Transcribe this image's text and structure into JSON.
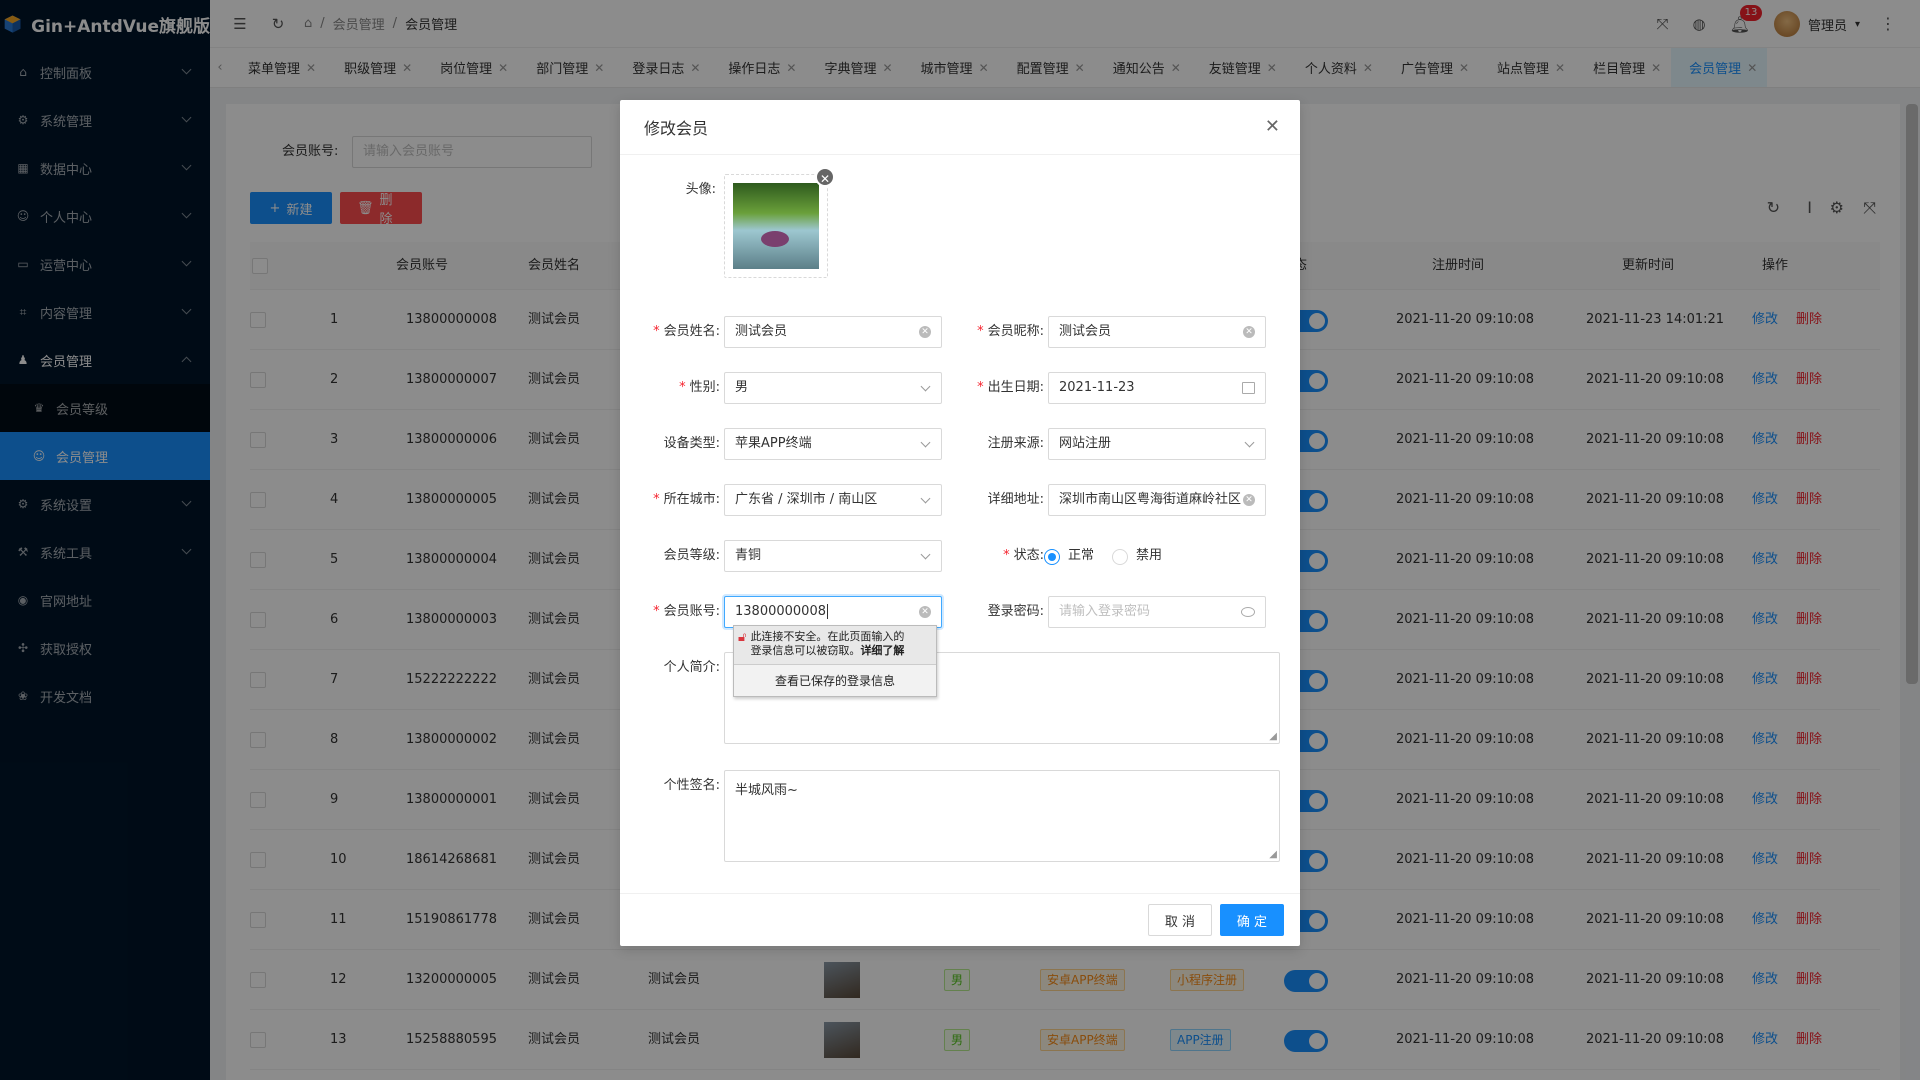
{
  "app": {
    "title": "Gin+AntdVue旗舰版"
  },
  "sidebar": {
    "items": [
      {
        "label": "控制面板",
        "icon": "home-icon"
      },
      {
        "label": "系统管理",
        "icon": "settings-icon"
      },
      {
        "label": "数据中心",
        "icon": "grid-icon"
      },
      {
        "label": "个人中心",
        "icon": "user-icon"
      },
      {
        "label": "运营中心",
        "icon": "monitor-icon"
      },
      {
        "label": "内容管理",
        "icon": "scan-icon"
      },
      {
        "label": "会员管理",
        "icon": "users-icon"
      },
      {
        "label": "会员等级",
        "icon": "crown-icon"
      },
      {
        "label": "会员管理",
        "icon": "user-icon"
      },
      {
        "label": "系统设置",
        "icon": "settings-icon"
      },
      {
        "label": "系统工具",
        "icon": "tool-icon"
      },
      {
        "label": "官网地址",
        "icon": "globe-icon"
      },
      {
        "label": "获取授权",
        "icon": "key-icon"
      },
      {
        "label": "开发文档",
        "icon": "doc-icon"
      }
    ]
  },
  "header": {
    "breadcrumb": [
      "会员管理",
      "会员管理"
    ],
    "notification_count": "13",
    "user_name": "管理员"
  },
  "tabs": [
    "菜单管理",
    "职级管理",
    "岗位管理",
    "部门管理",
    "登录日志",
    "操作日志",
    "字典管理",
    "城市管理",
    "配置管理",
    "通知公告",
    "友链管理",
    "个人资料",
    "广告管理",
    "站点管理",
    "栏目管理",
    "会员管理"
  ],
  "search": {
    "label": "会员账号:",
    "placeholder": "请输入会员账号"
  },
  "toolbar": {
    "new_label": "新建",
    "delete_label": "删除"
  },
  "table": {
    "headers": {
      "account": "会员账号",
      "name": "会员姓名",
      "status": "态",
      "reg_time": "注册时间",
      "upd_time": "更新时间",
      "ops": "操作"
    },
    "edit_label": "修改",
    "delete_label": "删除",
    "rows": [
      {
        "idx": "1",
        "account": "13800000008",
        "name": "测试会员",
        "reg": "2021-11-20 09:10:08",
        "upd": "2021-11-23 14:01:21"
      },
      {
        "idx": "2",
        "account": "13800000007",
        "name": "测试会员",
        "reg": "2021-11-20 09:10:08",
        "upd": "2021-11-20 09:10:08"
      },
      {
        "idx": "3",
        "account": "13800000006",
        "name": "测试会员",
        "reg": "2021-11-20 09:10:08",
        "upd": "2021-11-20 09:10:08"
      },
      {
        "idx": "4",
        "account": "13800000005",
        "name": "测试会员",
        "reg": "2021-11-20 09:10:08",
        "upd": "2021-11-20 09:10:08"
      },
      {
        "idx": "5",
        "account": "13800000004",
        "name": "测试会员",
        "reg": "2021-11-20 09:10:08",
        "upd": "2021-11-20 09:10:08"
      },
      {
        "idx": "6",
        "account": "13800000003",
        "name": "测试会员",
        "reg": "2021-11-20 09:10:08",
        "upd": "2021-11-20 09:10:08"
      },
      {
        "idx": "7",
        "account": "15222222222",
        "name": "测试会员",
        "reg": "2021-11-20 09:10:08",
        "upd": "2021-11-20 09:10:08"
      },
      {
        "idx": "8",
        "account": "13800000002",
        "name": "测试会员",
        "reg": "2021-11-20 09:10:08",
        "upd": "2021-11-20 09:10:08"
      },
      {
        "idx": "9",
        "account": "13800000001",
        "name": "测试会员",
        "reg": "2021-11-20 09:10:08",
        "upd": "2021-11-20 09:10:08"
      },
      {
        "idx": "10",
        "account": "18614268681",
        "name": "测试会员",
        "reg": "2021-11-20 09:10:08",
        "upd": "2021-11-20 09:10:08"
      },
      {
        "idx": "11",
        "account": "15190861778",
        "name": "测试会员",
        "reg": "2021-11-20 09:10:08",
        "upd": "2021-11-20 09:10:08"
      },
      {
        "idx": "12",
        "account": "13200000005",
        "name": "测试会员",
        "nick": "测试会员",
        "gender": "男",
        "device": "安卓APP终端",
        "source": "小程序注册",
        "reg": "2021-11-20 09:10:08",
        "upd": "2021-11-20 09:10:08"
      },
      {
        "idx": "13",
        "account": "15258880595",
        "name": "测试会员",
        "nick": "测试会员",
        "gender": "男",
        "device": "安卓APP终端",
        "source": "APP注册",
        "reg": "2021-11-20 09:10:08",
        "upd": "2021-11-20 09:10:08"
      }
    ]
  },
  "modal": {
    "title": "修改会员",
    "avatar_label": "头像:",
    "fields": {
      "name": {
        "label": "会员姓名:",
        "value": "测试会员"
      },
      "nickname": {
        "label": "会员昵称:",
        "value": "测试会员"
      },
      "gender": {
        "label": "性别:",
        "value": "男"
      },
      "birthday": {
        "label": "出生日期:",
        "value": "2021-11-23"
      },
      "device": {
        "label": "设备类型:",
        "value": "苹果APP终端"
      },
      "source": {
        "label": "注册来源:",
        "value": "网站注册"
      },
      "city": {
        "label": "所在城市:",
        "value": "广东省 / 深圳市 / 南山区"
      },
      "address": {
        "label": "详细地址:",
        "value": "深圳市南山区粤海街道麻岭社区"
      },
      "level": {
        "label": "会员等级:",
        "value": "青铜"
      },
      "status": {
        "label": "状态:",
        "opt_normal": "正常",
        "opt_disabled": "禁用",
        "selected": "正常"
      },
      "account": {
        "label": "会员账号:",
        "value": "13800000008"
      },
      "password": {
        "label": "登录密码:",
        "placeholder": "请输入登录密码"
      },
      "intro": {
        "label": "个人简介:",
        "value": ""
      },
      "signature": {
        "label": "个性签名:",
        "value": "半城风雨~"
      }
    },
    "cancel_label": "取 消",
    "ok_label": "确 定"
  },
  "autofill_popup": {
    "warning_line1": "此连接不安全。在此页面输入的",
    "warning_line2": "登录信息可以被窃取。",
    "learn_more": "详细了解",
    "saved_logins": "查看已保存的登录信息"
  },
  "colors": {
    "primary": "#1890ff",
    "danger": "#ff4d4f",
    "sidebar": "#001529"
  }
}
